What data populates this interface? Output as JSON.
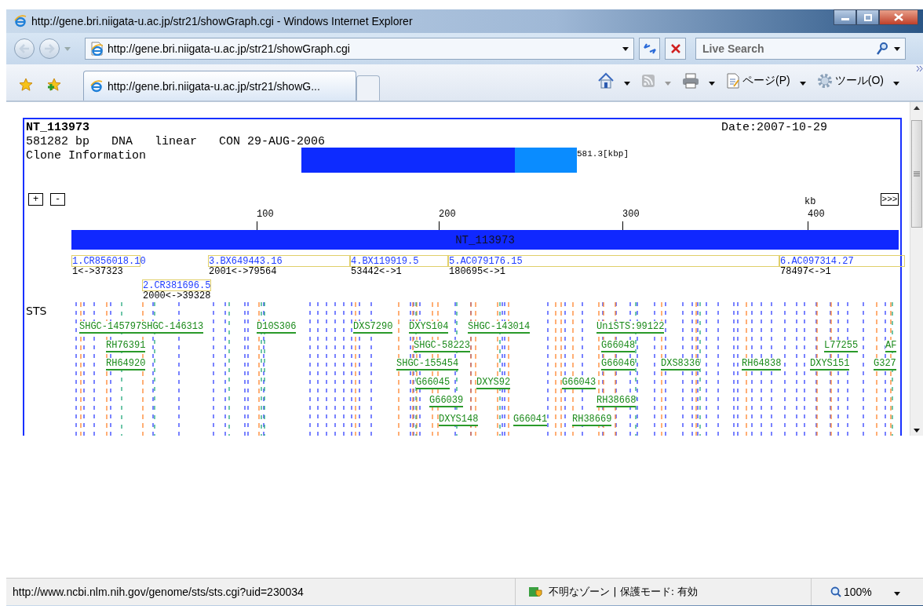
{
  "window": {
    "title": "http://gene.bri.niigata-u.ac.jp/str21/showGraph.cgi - Windows Internet Explorer"
  },
  "address_bar": {
    "url": "http://gene.bri.niigata-u.ac.jp/str21/showGraph.cgi"
  },
  "search": {
    "placeholder": "Live Search"
  },
  "tabs": [
    {
      "label": "http://gene.bri.niigata-u.ac.jp/str21/showG...",
      "selected": true
    }
  ],
  "command_bar": [
    {
      "kind": "home",
      "disabled": false
    },
    {
      "kind": "feeds",
      "disabled": true
    },
    {
      "kind": "print",
      "disabled": false
    },
    {
      "kind": "page",
      "label": "ページ(P)",
      "disabled": false
    },
    {
      "kind": "tools",
      "label": "ツール(O)",
      "disabled": false
    }
  ],
  "record": {
    "accession": "NT_113973",
    "length": "581282 bp",
    "molecule": "DNA",
    "topology": "linear",
    "division_date": "CON 29-AUG-2006",
    "date": "Date:2007-10-29",
    "clone_label": "Clone Information",
    "overview": {
      "level": 0.775,
      "reading": "581.3[kbp]"
    }
  },
  "zoom_buttons": [
    "+",
    "-"
  ],
  "next_button": ">>>",
  "axis": {
    "unit": "kb",
    "ticks": [
      "100",
      "200",
      "300",
      "400"
    ]
  },
  "sequence_bar": {
    "label": "NT_113973"
  },
  "clones": [
    {
      "name": "1.CR856018.10",
      "range": "1<->37323"
    },
    {
      "name": "2.CR381696.5",
      "range": "2000<->39328"
    },
    {
      "name": "3.BX649443.16",
      "range": "2001<->79564"
    },
    {
      "name": "4.BX119919.5",
      "range": "53442<->1"
    },
    {
      "name": "5.AC079176.15",
      "range": "180695<->1"
    },
    {
      "name": "6.AC097314.27",
      "range": "78497<->1"
    }
  ],
  "sts": {
    "label": "STS",
    "rows": [
      [
        "SHGC-145797",
        "SHGC-146313",
        "D10S306",
        "DXS7290",
        "DXYS104",
        "SHGC-143014",
        "UniSTS:99122"
      ],
      [
        "RH76391",
        "SHGC-58223",
        "G66048",
        "L77255",
        "AF"
      ],
      [
        "RH64920",
        "SHGC-155454",
        "G66046",
        "DXS8336",
        "RH64838",
        "DXYS151",
        "G327"
      ],
      [
        "G66045",
        "DXYS92",
        "G66043"
      ],
      [
        "G66039",
        "RH38668"
      ],
      [
        "DXYS148",
        "G66041",
        "RH38669"
      ]
    ]
  },
  "status_bar": {
    "url": "http://www.ncbi.nlm.nih.gov/genome/sts/sts.cgi?uid=230034",
    "zone": "不明なゾーン | 保護モード: 有効",
    "zoom": "100%"
  }
}
